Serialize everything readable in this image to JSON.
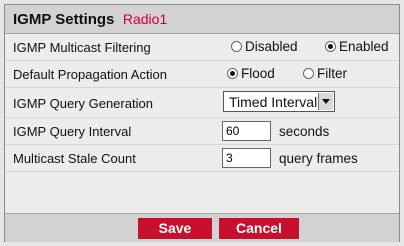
{
  "header": {
    "title": "IGMP Settings",
    "radio": "Radio1"
  },
  "rows": {
    "filtering": {
      "label": "IGMP Multicast Filtering",
      "options": [
        {
          "label": "Disabled",
          "selected": false
        },
        {
          "label": "Enabled",
          "selected": true
        }
      ]
    },
    "propagation": {
      "label": "Default Propagation Action",
      "options": [
        {
          "label": "Flood",
          "selected": true
        },
        {
          "label": "Filter",
          "selected": false
        }
      ]
    },
    "query_generation": {
      "label": "IGMP Query Generation",
      "value": "Timed Interval"
    },
    "query_interval": {
      "label": "IGMP Query Interval",
      "value": "60",
      "unit": "seconds"
    },
    "stale_count": {
      "label": "Multicast Stale Count",
      "value": "3",
      "unit": "query frames"
    }
  },
  "buttons": {
    "save": "Save",
    "cancel": "Cancel"
  },
  "colors": {
    "accent": "#cc0033",
    "button": "#c8102e"
  }
}
